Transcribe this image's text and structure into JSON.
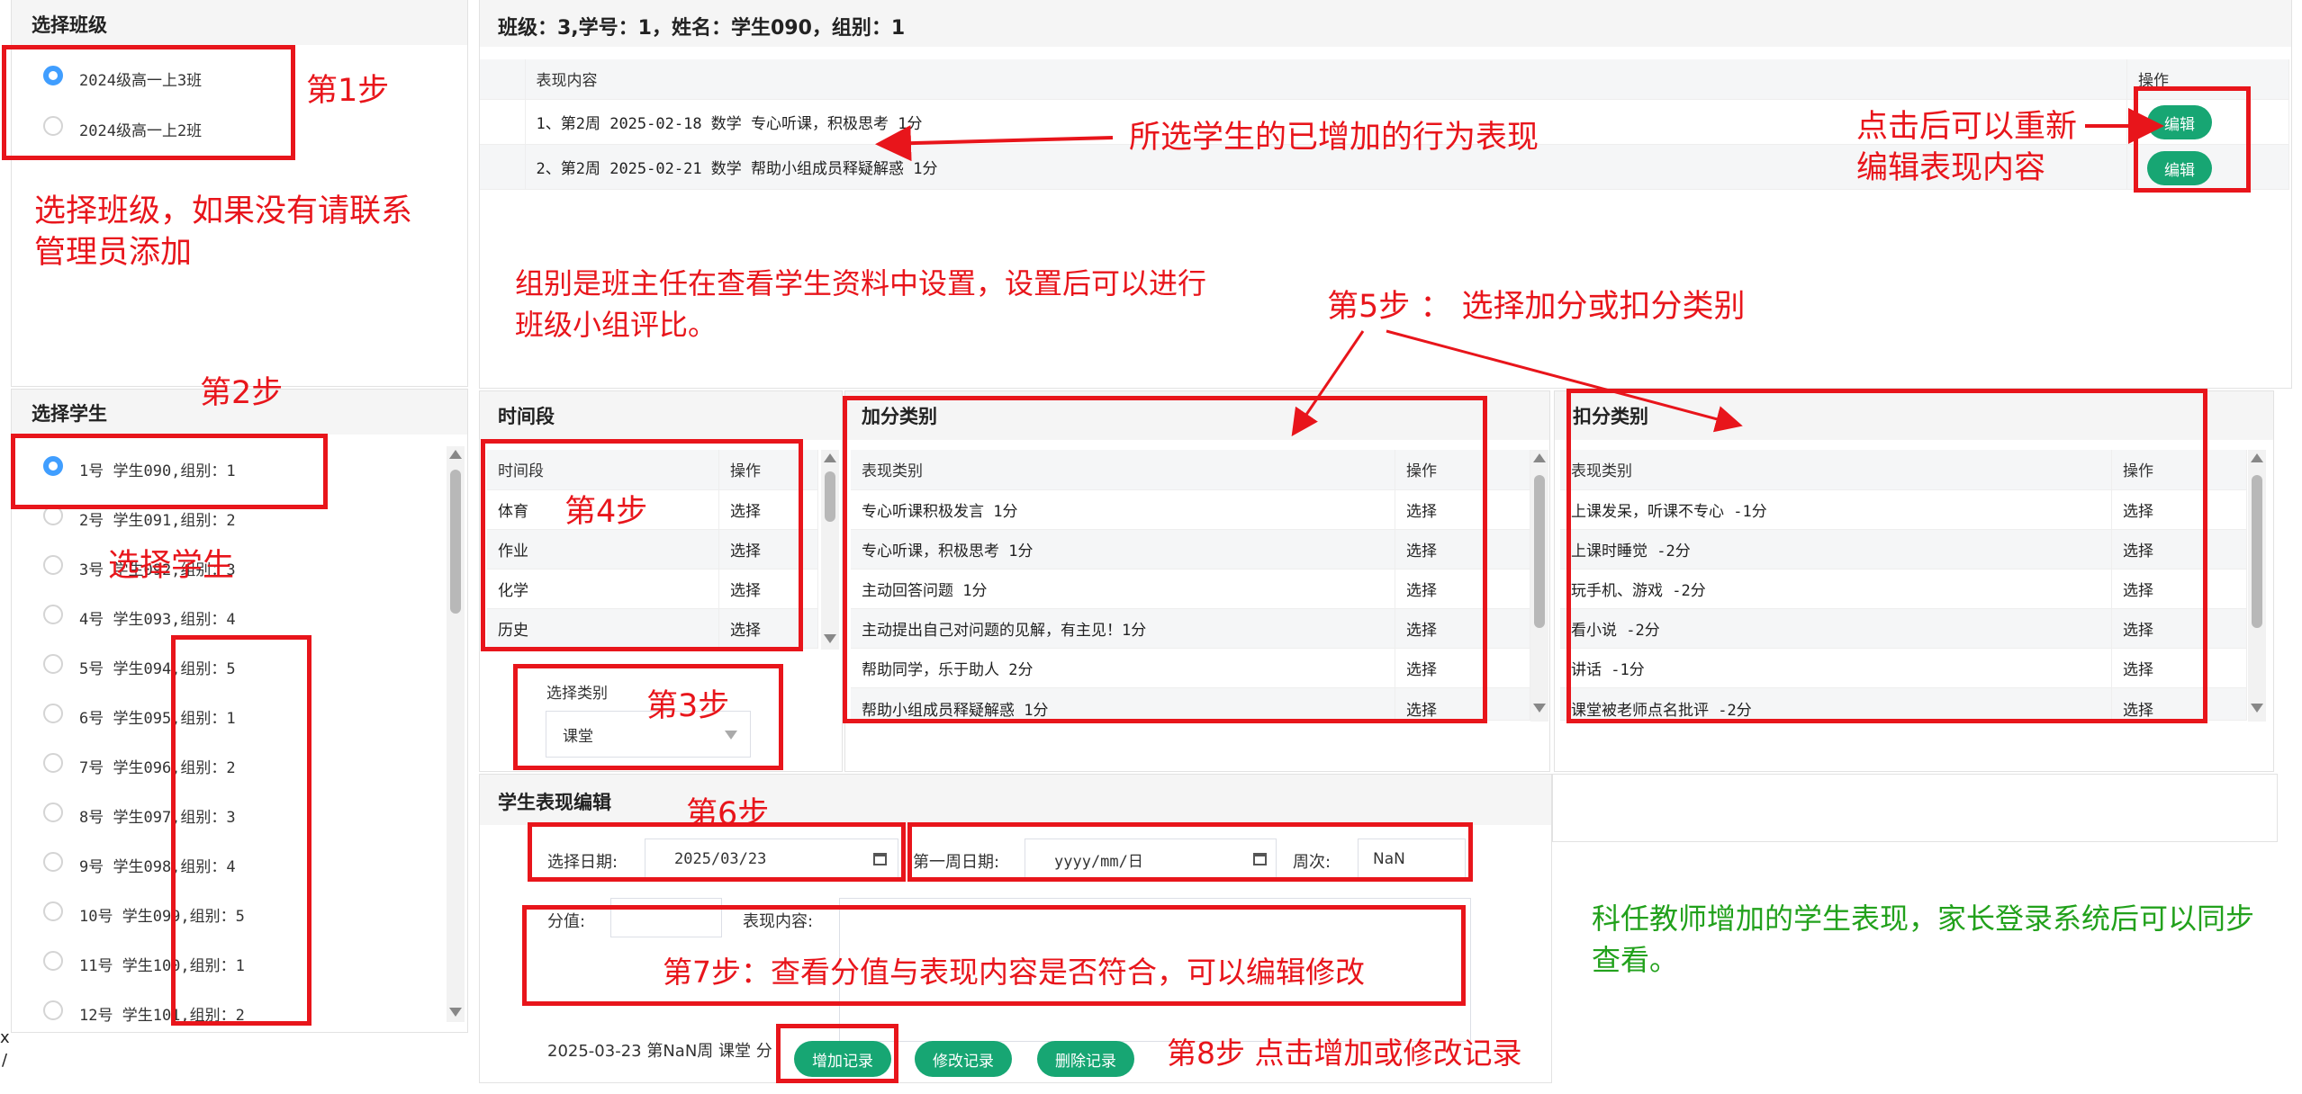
{
  "class_panel": {
    "title": "选择班级",
    "options": [
      "2024级高一上3班",
      "2024级高一上2班"
    ]
  },
  "student_panel": {
    "title": "选择学生",
    "students": [
      "1号 学生090,组别：1",
      "2号 学生091,组别：2",
      "3号 学生092,组别：3",
      "4号 学生093,组别：4",
      "5号 学生094,组别：5",
      "6号 学生095,组别：1",
      "7号 学生096,组别：2",
      "8号 学生097,组别：3",
      "9号 学生098,组别：4",
      "10号 学生099,组别：5",
      "11号 学生100,组别：1",
      "12号 学生101,组别：2"
    ]
  },
  "header": {
    "info": "班级：3,学号：1，姓名：学生090，组别：1"
  },
  "records": {
    "col_content": "表现内容",
    "col_op": "操作",
    "rows": [
      "1、第2周 2025-02-18 数学 专心听课，积极思考 1分",
      "2、第2周 2025-02-21 数学 帮助小组成员释疑解惑 1分"
    ],
    "edit_label": "编辑"
  },
  "period_panel": {
    "title": "时间段",
    "col_name": "时间段",
    "col_op": "操作",
    "rows": [
      "体育",
      "作业",
      "化学",
      "历史"
    ],
    "select_label": "选择"
  },
  "category_select": {
    "label": "选择类别",
    "value": "课堂"
  },
  "plus_panel": {
    "title": "加分类别",
    "col_name": "表现类别",
    "col_op": "操作",
    "rows": [
      "专心听课积极发言 1分",
      "专心听课，积极思考 1分",
      "主动回答问题 1分",
      "主动提出自己对问题的见解，有主见！1分",
      "帮助同学，乐于助人 2分",
      "帮助小组成员释疑解惑 1分"
    ]
  },
  "minus_panel": {
    "title": "扣分类别",
    "col_name": "表现类别",
    "col_op": "操作",
    "rows": [
      "上课发呆，听课不专心 -1分",
      "上课时睡觉 -2分",
      "玩手机、游戏 -2分",
      "看小说 -2分",
      "讲话 -1分",
      "课堂被老师点名批评 -2分"
    ]
  },
  "edit_panel": {
    "title": "学生表现编辑",
    "date_label": "选择日期:",
    "date_value": "2025/03/23",
    "week1_label": "第一周日期:",
    "week1_placeholder": "yyyy/mm/日",
    "week_no_label": "周次:",
    "week_no_value": "NaN",
    "score_label": "分值:",
    "content_label": "表现内容:",
    "summary": "2025-03-23 第NaN周 课堂 分",
    "add_btn": "增加记录",
    "modify_btn": "修改记录",
    "delete_btn": "删除记录"
  },
  "annotations": {
    "step1": "第1步",
    "class_hint": "选择班级，如果没有请联系\n管理员添加",
    "step2": "第2步",
    "select_student": "选择学生",
    "records_hint": "所选学生的已增加的行为表现",
    "edit_hint": "点击后可以重新\n编辑表现内容",
    "group_hint": "组别是班主任在查看学生资料中设置，设置后可以进行\n班级小组评比。",
    "step5": "第5步 ： 选择加分或扣分类别",
    "step4": "第4步",
    "step3": "第3步",
    "step6": "第6步",
    "step7": "第7步：查看分值与表现内容是否符合，可以编辑修改",
    "step8": "第8步 点击增加或修改记录",
    "parent_hint": "科任教师增加的学生表现，家长登录系统后可以同步\n查看。"
  },
  "stray": {
    "x": "x",
    "slash": "/"
  },
  "colors": {
    "accent_blue": "#409eff",
    "button_green": "#17a673",
    "annotation_red": "#e8151b",
    "annotation_green": "#22a11c"
  }
}
